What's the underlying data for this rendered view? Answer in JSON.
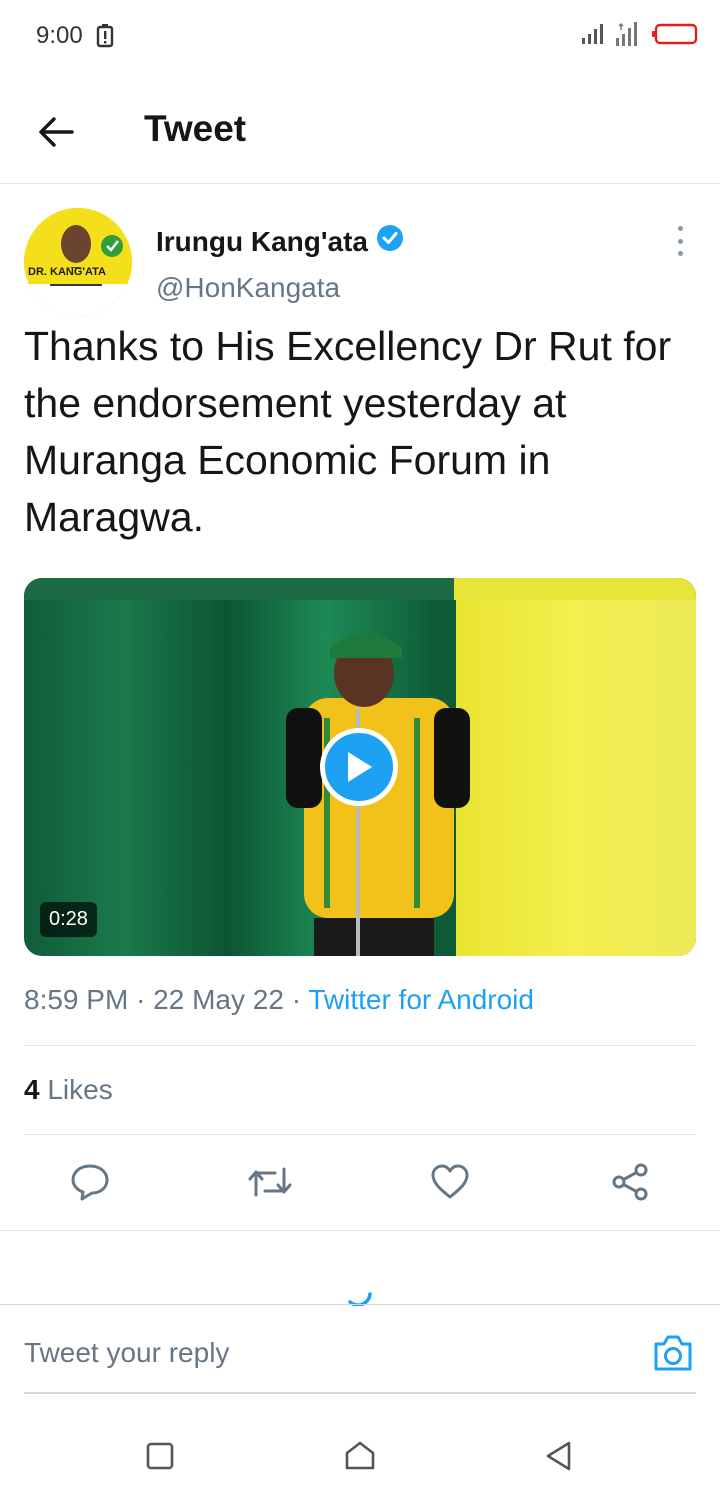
{
  "status_bar": {
    "time": "9:00"
  },
  "header": {
    "title": "Tweet"
  },
  "tweet": {
    "author_name": "Irungu Kang'ata",
    "author_handle": "@HonKangata",
    "avatar_text": "DR. KANG'ATA",
    "text": "Thanks to His Excellency Dr Rut for the endorsement yesterday at Muranga Economic Forum in Maragwa.",
    "media": {
      "duration": "0:28"
    },
    "time": "8:59 PM",
    "separator": "·",
    "date": "22 May 22",
    "source": "Twitter for Android",
    "likes_count": "4",
    "likes_label": "Likes"
  },
  "reply": {
    "placeholder": "Tweet your reply"
  },
  "colors": {
    "accent": "#1da1f2",
    "text": "#14171a",
    "secondary": "#657786",
    "divider": "#e1e8ed"
  }
}
